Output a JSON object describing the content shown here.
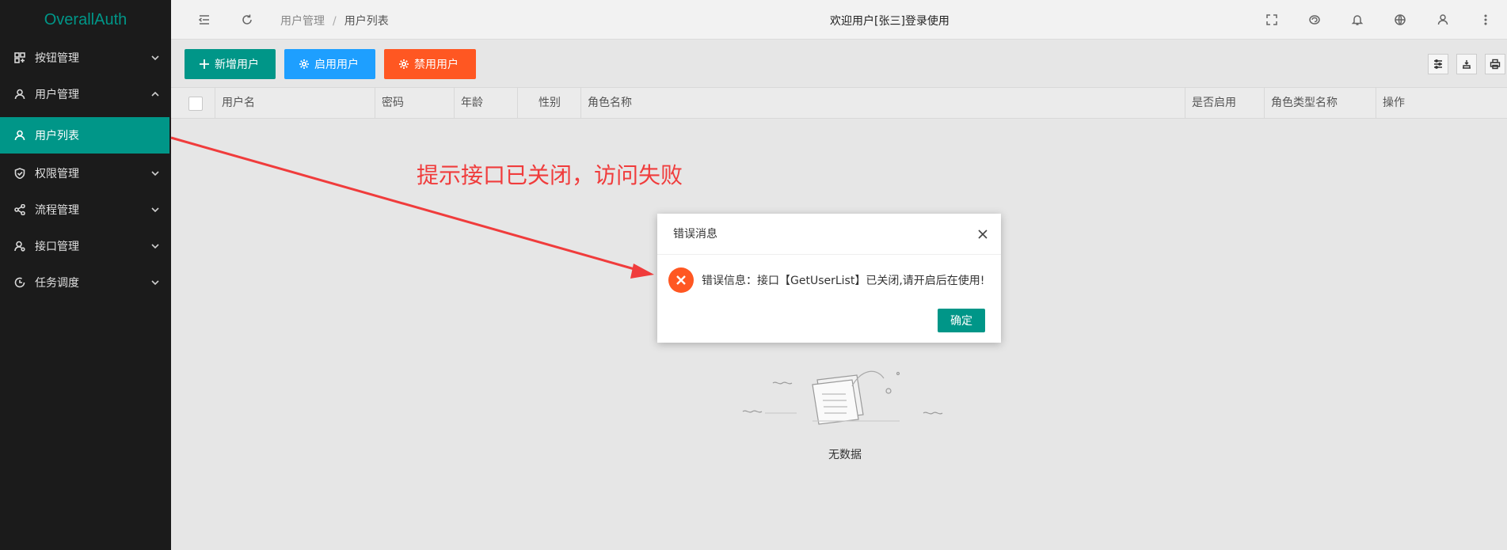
{
  "app": {
    "logo": "OverallAuth"
  },
  "sidebar": {
    "items": [
      {
        "label": "按钮管理",
        "icon": "grid-icon",
        "expanded": false
      },
      {
        "label": "用户管理",
        "icon": "user-icon",
        "expanded": true
      },
      {
        "label": "用户列表",
        "icon": "user-icon",
        "active": true
      },
      {
        "label": "权限管理",
        "icon": "shield-icon",
        "expanded": false
      },
      {
        "label": "流程管理",
        "icon": "share-icon",
        "expanded": false
      },
      {
        "label": "接口管理",
        "icon": "user-gear-icon",
        "expanded": false
      },
      {
        "label": "任务调度",
        "icon": "schedule-icon",
        "expanded": false
      }
    ]
  },
  "header": {
    "breadcrumb": [
      "用户管理",
      "用户列表"
    ],
    "breadcrumb_sep": "/",
    "welcome": "欢迎用户[张三]登录使用"
  },
  "toolbar": {
    "add_label": "新增用户",
    "enable_label": "启用用户",
    "disable_label": "禁用用户"
  },
  "table": {
    "columns": [
      "用户名",
      "密码",
      "年龄",
      "性别",
      "角色名称",
      "是否启用",
      "角色类型名称",
      "操作"
    ],
    "empty_text": "无数据"
  },
  "annotation": {
    "text": "提示接口已关闭，访问失败"
  },
  "dialog": {
    "title": "错误消息",
    "message": "错误信息：接口【GetUserList】已关闭,请开启后在使用!",
    "ok_label": "确定"
  },
  "colors": {
    "primary": "#009688",
    "blue": "#1e9fff",
    "orange": "#ff5722",
    "annotation": "#f03c3c"
  }
}
